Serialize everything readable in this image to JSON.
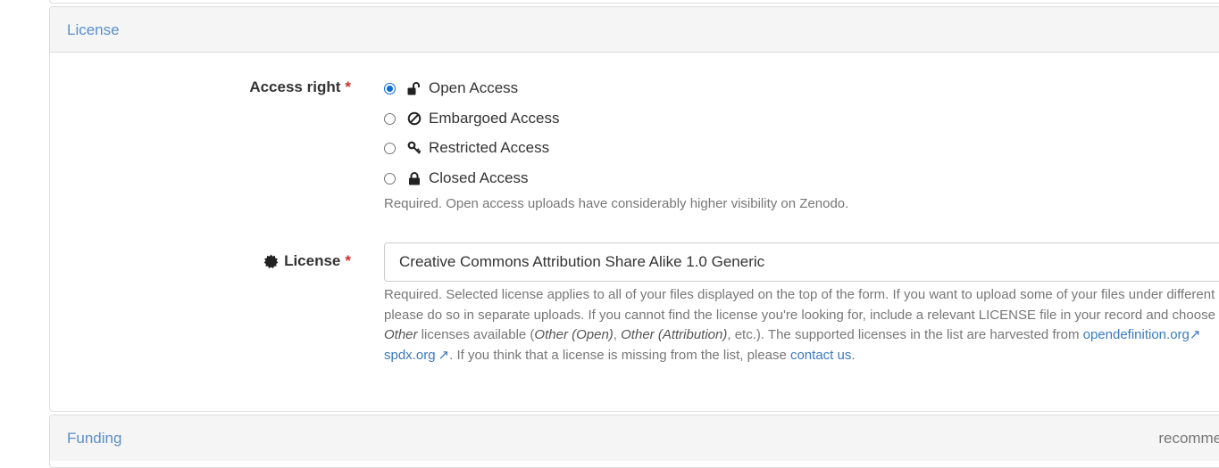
{
  "license_section": {
    "heading": "License",
    "access_right": {
      "label": "Access right",
      "required_mark": "*",
      "options": [
        {
          "label": "Open Access",
          "icon": "unlock-icon",
          "selected": true
        },
        {
          "label": "Embargoed Access",
          "icon": "ban-icon",
          "selected": false
        },
        {
          "label": "Restricted Access",
          "icon": "key-icon",
          "selected": false
        },
        {
          "label": "Closed Access",
          "icon": "lock-icon",
          "selected": false
        }
      ],
      "help": "Required. Open access uploads have considerably higher visibility on Zenodo."
    },
    "license": {
      "label": "License",
      "icon": "certificate-icon",
      "required_mark": "*",
      "value": "Creative Commons Attribution Share Alike 1.0 Generic",
      "help": {
        "line1": "Required. Selected license applies to all of your files displayed on the top of the form. If you want to upload some of your files under different licenses,",
        "line2": "please do so in separate uploads. If you cannot find the license you're looking for, include a relevant LICENSE file in your record and choose one of the",
        "other": "Other",
        "licenses_available": " licenses available (",
        "other_open": "Other (Open)",
        "comma": ", ",
        "other_attribution": "Other (Attribution)",
        "etc": ", etc.). The supported licenses in the list are harvested from ",
        "opendefinition_link": "opendefinition.org",
        "spdx_link": "spdx.org",
        "missing": ". If you think that a license is missing from the list, please ",
        "contact_link": "contact us",
        "end": "."
      }
    }
  },
  "funding_section": {
    "heading": "Funding",
    "recommended": "recommended"
  },
  "colors": {
    "link": "#3a7ac0",
    "required": "#c9302c",
    "radio_selected": "#0b6cd6"
  }
}
